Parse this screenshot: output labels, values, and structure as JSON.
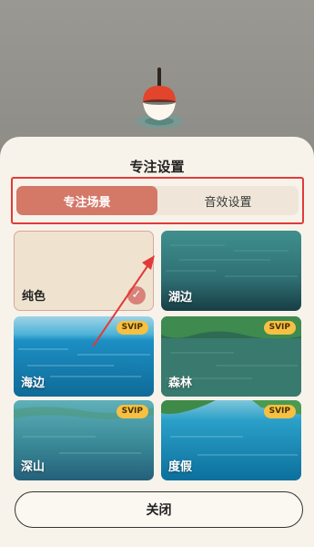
{
  "settings_sheet": {
    "title": "专注设置",
    "tabs": [
      {
        "label": "专注场景",
        "active": true
      },
      {
        "label": "音效设置",
        "active": false
      }
    ],
    "scenes": [
      {
        "label": "纯色",
        "selected": true,
        "svip": false
      },
      {
        "label": "湖边",
        "selected": false,
        "svip": false
      },
      {
        "label": "海边",
        "selected": false,
        "svip": true,
        "badge": "SVIP"
      },
      {
        "label": "森林",
        "selected": false,
        "svip": true,
        "badge": "SVIP"
      },
      {
        "label": "深山",
        "selected": false,
        "svip": true,
        "badge": "SVIP"
      },
      {
        "label": "度假",
        "selected": false,
        "svip": true,
        "badge": "SVIP"
      }
    ],
    "close_label": "关闭",
    "check_icon": "checkmark-icon"
  },
  "colors": {
    "sheet_background": "#f7f3ea",
    "active_tab": "#d47868",
    "tab_track": "#efe6d9",
    "annotation_red": "#e23a3a",
    "svip_badge": "#f5c043",
    "plain_scene": "#efe3cf"
  }
}
